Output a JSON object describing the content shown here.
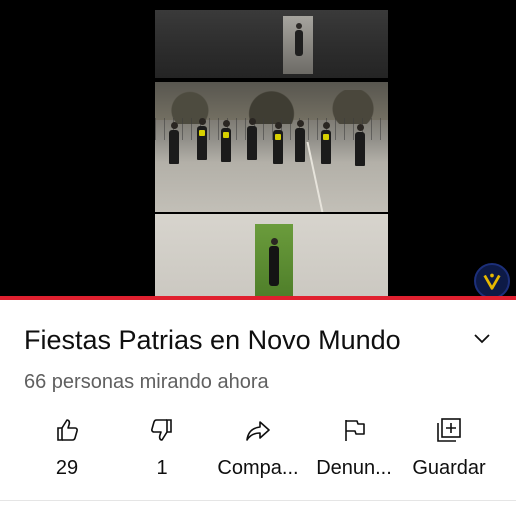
{
  "video": {
    "progress_percent": 100,
    "badge_icon": "channel-logo-icon",
    "progress_color": "#e0202f"
  },
  "info": {
    "title": "Fiestas Patrias en Novo Mundo",
    "viewers": "66 personas mirando ahora",
    "expand_icon": "chevron-down-icon"
  },
  "actions": [
    {
      "icon": "thumbs-up-icon",
      "label": "29"
    },
    {
      "icon": "thumbs-down-icon",
      "label": "1"
    },
    {
      "icon": "share-icon",
      "label": "Compa..."
    },
    {
      "icon": "flag-icon",
      "label": "Denun..."
    },
    {
      "icon": "save-playlist-icon",
      "label": "Guardar"
    }
  ]
}
